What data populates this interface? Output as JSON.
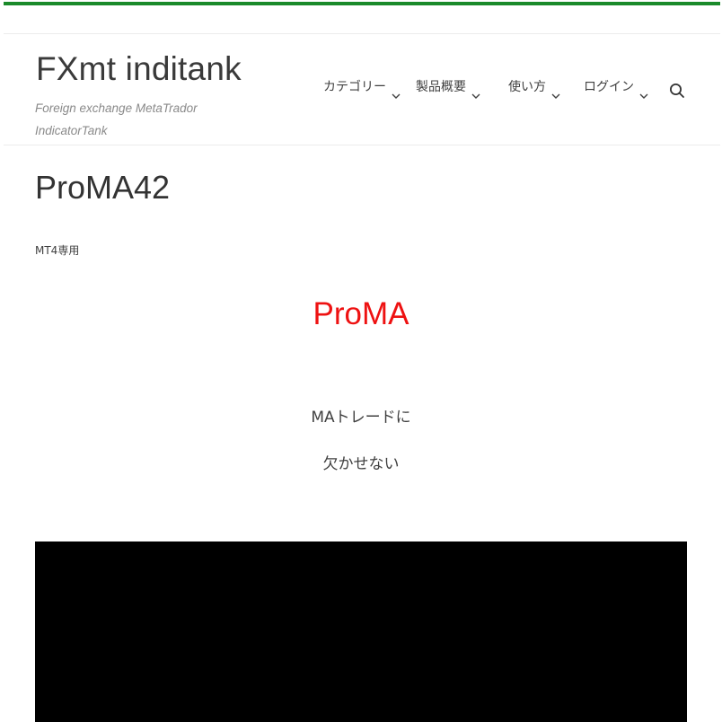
{
  "header": {
    "site_title": "FXmt inditank",
    "tagline": "Foreign exchange MetaTrador IndicatorTank",
    "colors": {
      "top_bar": "#1a8a2a",
      "hero_text": "#ee1111"
    }
  },
  "nav": {
    "items": [
      {
        "label": "カテゴリー",
        "icon": "chevron-down-icon"
      },
      {
        "label": "製品概要",
        "icon": "chevron-down-icon"
      },
      {
        "label": "使い方",
        "icon": "chevron-down-icon"
      },
      {
        "label": "ログイン",
        "icon": "chevron-down-icon"
      }
    ],
    "search_icon": "search-icon"
  },
  "main": {
    "page_title": "ProMA42",
    "tag": "MT4専用",
    "hero_heading": "ProMA",
    "lines": [
      "MAトレードに",
      "欠かせない"
    ]
  }
}
